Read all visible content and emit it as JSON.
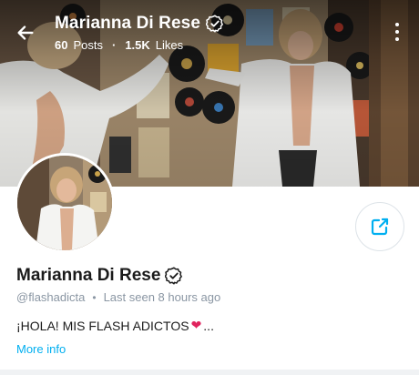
{
  "header": {
    "creator_name": "Marianna Di Rese",
    "posts_count": "60",
    "posts_label": "Posts",
    "likes_count": "1.5K",
    "likes_label": "Likes"
  },
  "profile": {
    "name": "Marianna Di Rese",
    "handle": "@flashadicta",
    "last_seen": "Last seen 8 hours ago",
    "bio": "¡HOLA! MIS FLASH ADICTOS",
    "bio_emoji": "❤",
    "bio_ellipsis": "...",
    "more_info_label": "More info"
  },
  "colors": {
    "accent": "#00aff0",
    "muted_text": "#8a96a3",
    "heart": "#e0245e"
  },
  "icons": {
    "back": "arrow-left-icon",
    "verified": "verified-badge-icon",
    "menu": "more-vertical-icon",
    "share": "share-icon"
  }
}
